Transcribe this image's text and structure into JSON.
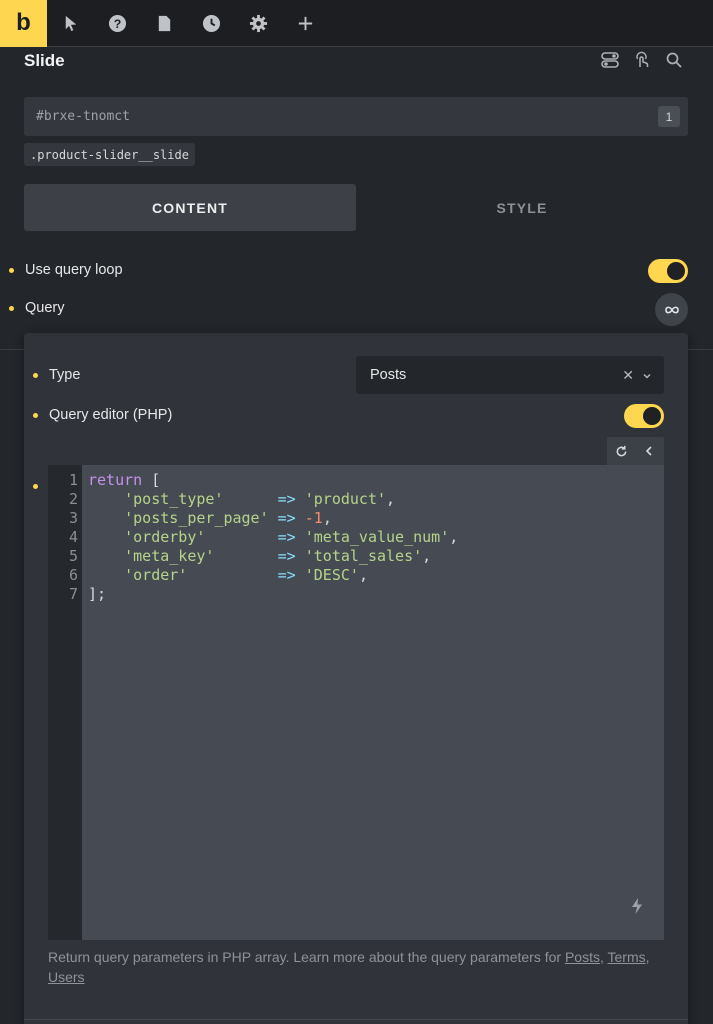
{
  "topbar": {
    "logo": "b",
    "icons": [
      "cursor-icon",
      "help-icon",
      "page-icon",
      "clock-icon",
      "gear-icon",
      "plus-icon"
    ]
  },
  "panel": {
    "title": "Slide",
    "tools": [
      "toggle-list-icon",
      "touch-icon",
      "search-icon"
    ]
  },
  "element": {
    "id_value": "#brxe-tnomct",
    "count": "1",
    "class_chip": ".product-slider__slide"
  },
  "tabs": [
    {
      "label": "CONTENT",
      "active": true
    },
    {
      "label": "STYLE",
      "active": false
    }
  ],
  "controls": {
    "use_query_loop": {
      "label": "Use query loop",
      "enabled": true
    },
    "query": {
      "label": "Query"
    }
  },
  "query_popup": {
    "type_label": "Type",
    "type_value": "Posts",
    "editor_label": "Query editor (PHP)",
    "editor_enabled": true,
    "code_lines": [
      {
        "n": "1",
        "tokens": [
          {
            "t": "return",
            "c": "kw"
          },
          {
            "t": " [",
            "c": "p"
          }
        ]
      },
      {
        "n": "2",
        "tokens": [
          {
            "t": "    ",
            "c": "p"
          },
          {
            "t": "'post_type'",
            "c": "s"
          },
          {
            "t": "      ",
            "c": "p"
          },
          {
            "t": "=>",
            "c": "op"
          },
          {
            "t": " ",
            "c": "p"
          },
          {
            "t": "'product'",
            "c": "s"
          },
          {
            "t": ",",
            "c": "p"
          }
        ]
      },
      {
        "n": "3",
        "tokens": [
          {
            "t": "    ",
            "c": "p"
          },
          {
            "t": "'posts_per_page'",
            "c": "s"
          },
          {
            "t": " ",
            "c": "p"
          },
          {
            "t": "=>",
            "c": "op"
          },
          {
            "t": " ",
            "c": "p"
          },
          {
            "t": "-1",
            "c": "num"
          },
          {
            "t": ",",
            "c": "p"
          }
        ]
      },
      {
        "n": "4",
        "tokens": [
          {
            "t": "    ",
            "c": "p"
          },
          {
            "t": "'orderby'",
            "c": "s"
          },
          {
            "t": "        ",
            "c": "p"
          },
          {
            "t": "=>",
            "c": "op"
          },
          {
            "t": " ",
            "c": "p"
          },
          {
            "t": "'meta_value_num'",
            "c": "s"
          },
          {
            "t": ",",
            "c": "p"
          }
        ]
      },
      {
        "n": "5",
        "tokens": [
          {
            "t": "    ",
            "c": "p"
          },
          {
            "t": "'meta_key'",
            "c": "s"
          },
          {
            "t": "       ",
            "c": "p"
          },
          {
            "t": "=>",
            "c": "op"
          },
          {
            "t": " ",
            "c": "p"
          },
          {
            "t": "'total_sales'",
            "c": "s"
          },
          {
            "t": ",",
            "c": "p"
          }
        ]
      },
      {
        "n": "6",
        "tokens": [
          {
            "t": "    ",
            "c": "p"
          },
          {
            "t": "'order'",
            "c": "s"
          },
          {
            "t": "          ",
            "c": "p"
          },
          {
            "t": "=>",
            "c": "op"
          },
          {
            "t": " ",
            "c": "p"
          },
          {
            "t": "'DESC'",
            "c": "s"
          },
          {
            "t": ",",
            "c": "p"
          }
        ]
      },
      {
        "n": "7",
        "tokens": [
          {
            "t": "];",
            "c": "p"
          }
        ]
      }
    ],
    "help_prefix": "Return query parameters in PHP array. Learn more about the query parameters for ",
    "help_link_posts": "Posts",
    "help_sep1": ", ",
    "help_link_terms": "Terms",
    "help_sep2": ", ",
    "help_link_users": "Users"
  },
  "colors": {
    "accent": "#ffd64f",
    "keyword": "#c792ea",
    "string": "#b5d38a",
    "operator": "#89ddff",
    "number": "#f78c6c"
  }
}
